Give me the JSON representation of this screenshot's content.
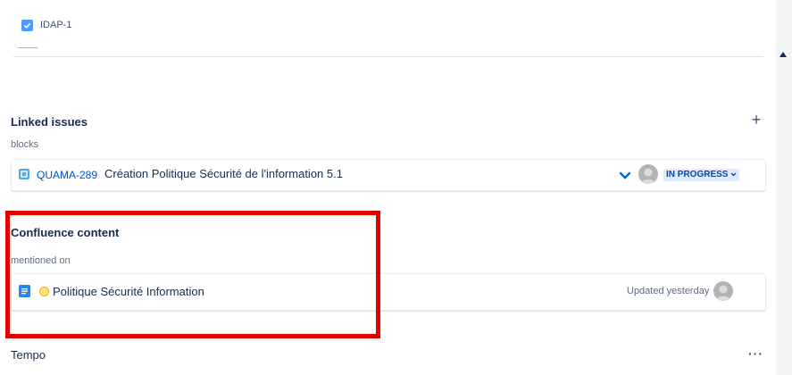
{
  "top_item": {
    "key": "IDAP-1"
  },
  "linked_issues": {
    "title": "Linked issues",
    "relation": "blocks",
    "add_button": "+",
    "items": [
      {
        "key": "QUAMA-289",
        "summary": "Création Politique Sécurité de l'information 5.1",
        "status": "IN PROGRESS",
        "status_caret": "⌄"
      }
    ]
  },
  "confluence": {
    "title": "Confluence content",
    "relation": "mentioned on",
    "items": [
      {
        "title": "Politique Sécurité Information",
        "updated": "Updated yesterday"
      }
    ]
  },
  "tempo": {
    "title": "Tempo",
    "more_button": "···"
  },
  "colors": {
    "link": "#0052cc",
    "status_bg": "#deebff",
    "status_text": "#0747a6",
    "highlight": "#e00000",
    "checkbox": "#4c9aff"
  }
}
